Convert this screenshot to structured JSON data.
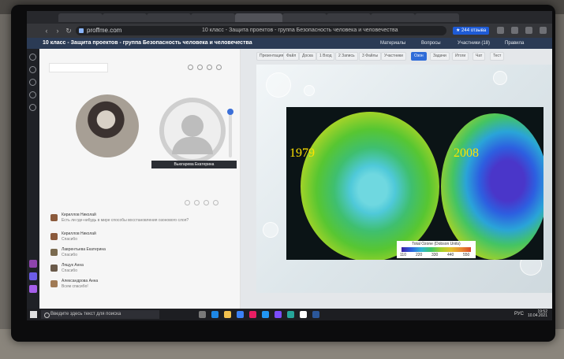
{
  "browser": {
    "url": "proffme.com",
    "page_tab_title": "10 класс - Защита проектов - группа Безопасность человека и человечества",
    "reviews_chip": "★ 244 отзыва"
  },
  "app": {
    "title": "10 класс - Защита проектов - группа Безопасность человека и человечества",
    "header_links": [
      "Материалы",
      "Вопросы",
      "Участники (18)",
      "Правила"
    ]
  },
  "video": {
    "participant_name": "Вьюгарева Екатерина"
  },
  "chat": {
    "messages": [
      {
        "name": "Кириллов Николай",
        "text": "Есть ли где-нибудь в мире способы восстановления озонового слоя?"
      },
      {
        "name": "Кириллов Николай",
        "text": "Спасибо"
      },
      {
        "name": "Лаврентьева Екатерина",
        "text": "Спасибо"
      },
      {
        "name": "Лящук Анна",
        "text": "Спасибо"
      },
      {
        "name": "Александрова Анна",
        "text": "Всем спасибо!"
      }
    ]
  },
  "slide": {
    "tabs": [
      "Презентация",
      "Файл",
      "Доска",
      "1 Вход",
      "2 Запись",
      "3 Файлы",
      "Участники",
      "Озон",
      "Задачи",
      "Итоги",
      "Чат",
      "Тест"
    ],
    "active_tab_index": 7,
    "year_left": "1979",
    "year_right": "2008",
    "legend_title": "Total Ozone (Dobson Units)",
    "legend_ticks": [
      "110",
      "220",
      "330",
      "440",
      "550"
    ]
  },
  "taskbar": {
    "search_placeholder": "Введите здесь текст для поиска",
    "language": "РУС",
    "time": "19:52",
    "date": "10.04.2021"
  },
  "colors": {
    "app_header": "#2b3b55",
    "accent": "#2f6cd8",
    "year_label": "#ffe300"
  }
}
